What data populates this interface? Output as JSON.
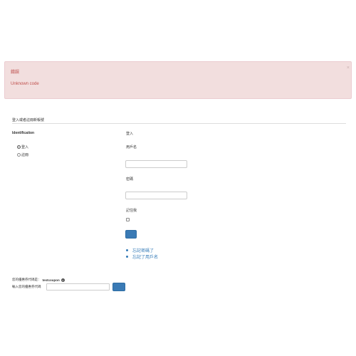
{
  "alert": {
    "title": "錯誤",
    "message": "Unknown code",
    "close_symbol": "×"
  },
  "section": {
    "legend": "登入或者註冊新帳號"
  },
  "identification": {
    "label": "Identification",
    "options": [
      {
        "label": "登入",
        "selected": true
      },
      {
        "label": "註冊",
        "selected": false
      }
    ]
  },
  "login": {
    "heading": "登入",
    "username_label": "用戶名",
    "username_value": "",
    "password_label": "密碼",
    "password_value": "",
    "remember_label": "記住我",
    "remember_checked": false,
    "links": [
      {
        "label": "忘記密碼了"
      },
      {
        "label": "忘記了用戶名"
      }
    ]
  },
  "coupon": {
    "current_label": "您的優惠券代碼是：",
    "current_code": "testcoupon",
    "enter_label": "輸入您的優惠券代碼",
    "input_value": ""
  },
  "colors": {
    "alert_bg": "#f2dede",
    "alert_text": "#c0504d",
    "primary": "#3a7ab5",
    "link": "#337ab7"
  }
}
